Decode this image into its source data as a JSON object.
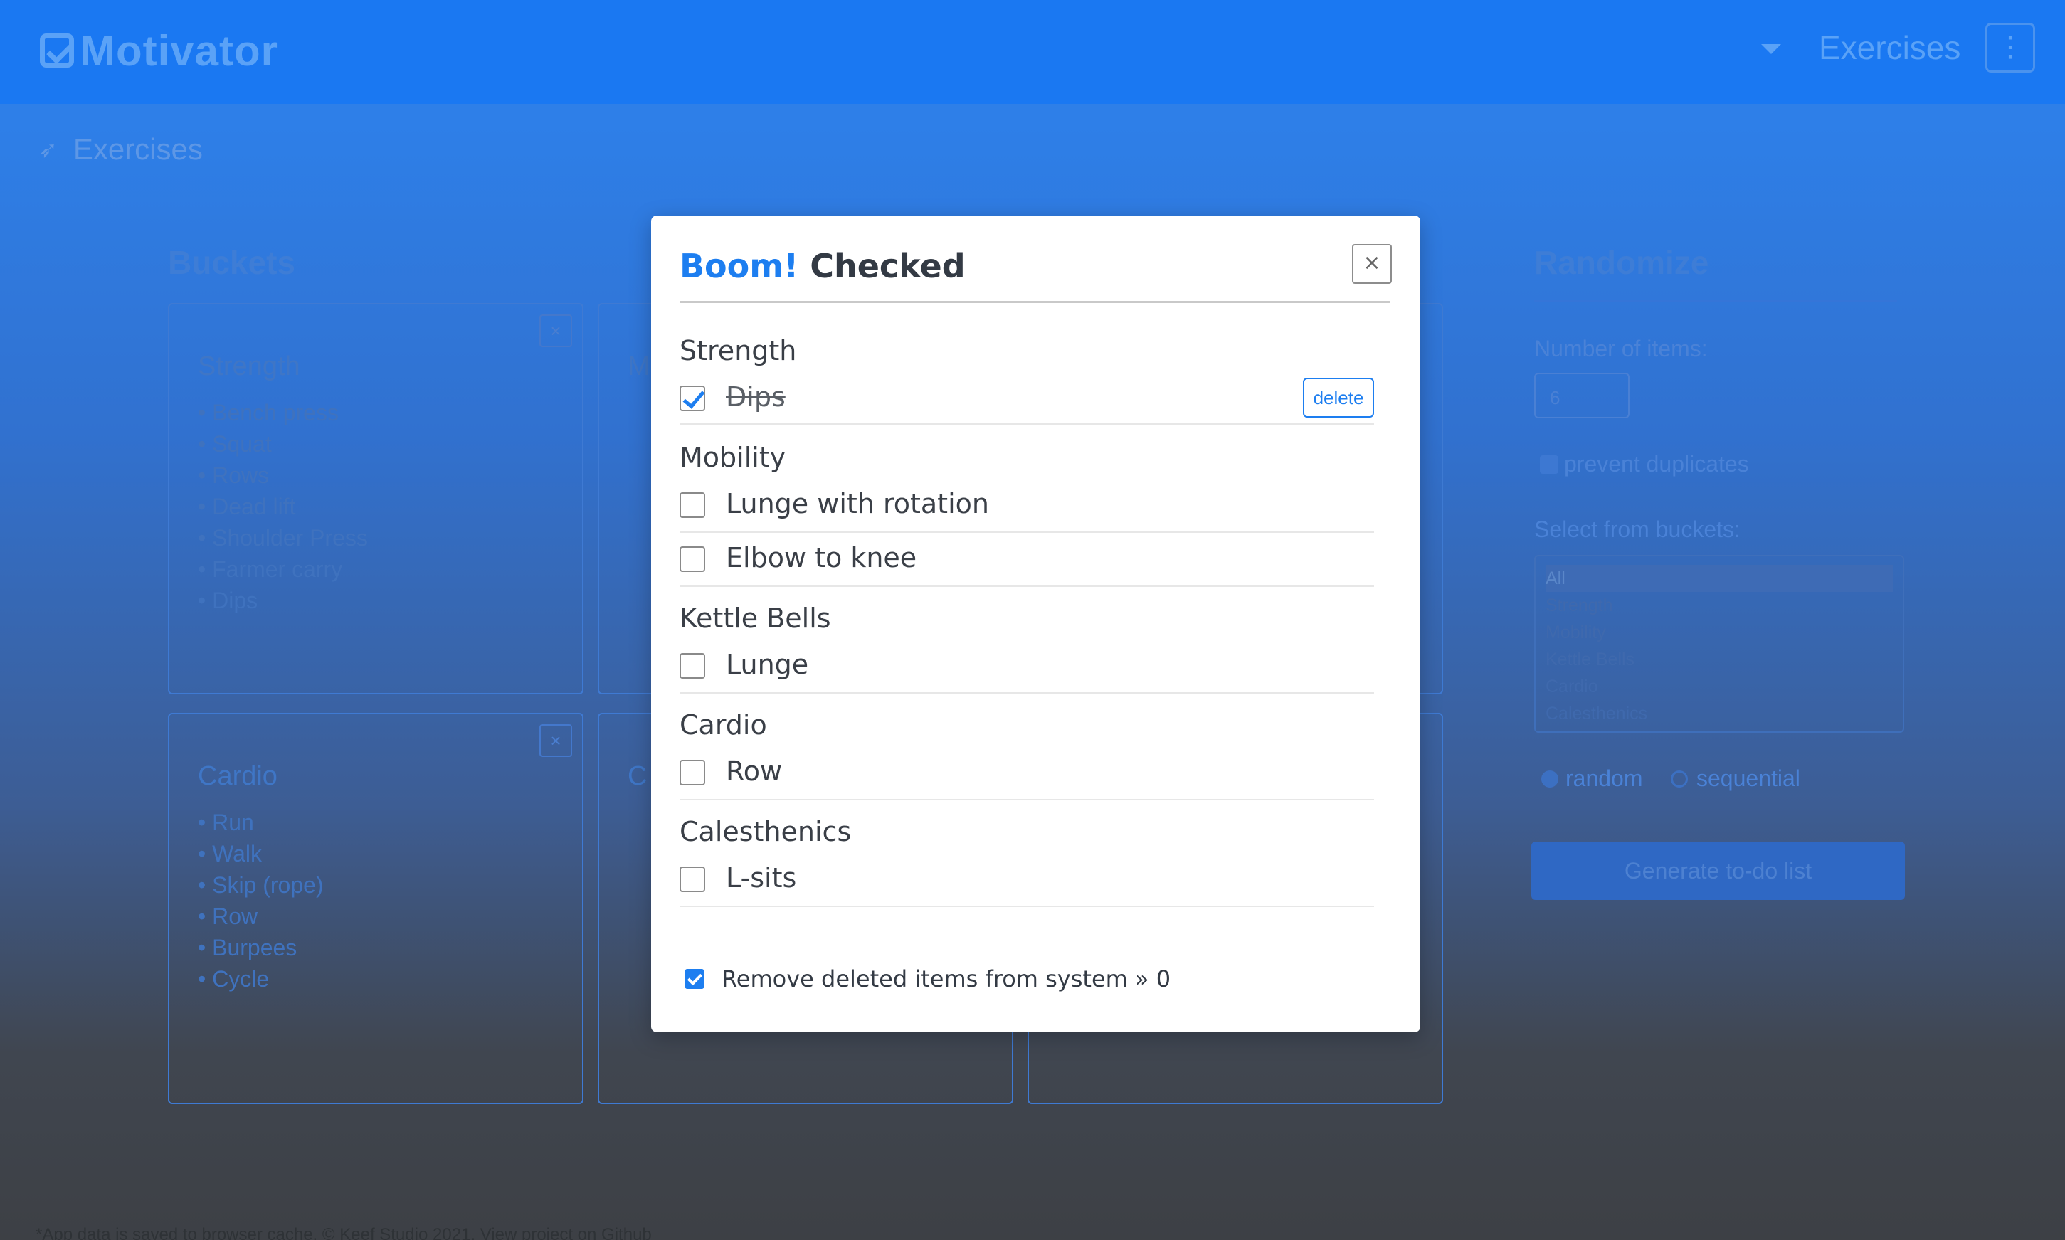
{
  "navbar": {
    "brand": "Motivator",
    "nav_link": "Exercises",
    "menu_glyph": "⋮"
  },
  "page": {
    "heading": "Exercises"
  },
  "buckets": {
    "title": "Buckets",
    "cards": [
      {
        "title": "Strength",
        "items": [
          "Bench press",
          "Squat",
          "Rows",
          "Dead lift",
          "Shoulder Press",
          "Farmer carry",
          "Dips"
        ]
      },
      {
        "title": "M"
      },
      {
        "title": "Cardio",
        "items": [
          "Run",
          "Walk",
          "Skip (rope)",
          "Row",
          "Burpees",
          "Cycle"
        ]
      },
      {
        "title": "C"
      }
    ]
  },
  "randomize": {
    "title": "Randomize",
    "number_label": "Number of items:",
    "number_value": "6",
    "prevent_duplicates_label": "prevent duplicates",
    "select_label": "Select from buckets:",
    "bucket_options": [
      "All",
      "Strength",
      "Mobility",
      "Kettle Bells",
      "Cardio",
      "Calesthenics"
    ],
    "random_label": "random",
    "sequential_label": "sequential",
    "generate_label": "Generate to-do list"
  },
  "footer": {
    "note": "*App data is saved to browser cache. © Keef Studio 2021. View project on Github"
  },
  "modal": {
    "title_accent": "Boom!",
    "title_rest": " Checked",
    "close_glyph": "×",
    "groups": [
      {
        "title": "Strength",
        "items": [
          {
            "label": "Dips",
            "checked": true
          }
        ]
      },
      {
        "title": "Mobility",
        "items": [
          {
            "label": "Lunge with rotation",
            "checked": false
          },
          {
            "label": "Elbow to knee",
            "checked": false
          }
        ]
      },
      {
        "title": "Kettle Bells",
        "items": [
          {
            "label": "Lunge",
            "checked": false
          }
        ]
      },
      {
        "title": "Cardio",
        "items": [
          {
            "label": "Row",
            "checked": false
          }
        ]
      },
      {
        "title": "Calesthenics",
        "items": [
          {
            "label": "L-sits",
            "checked": false
          }
        ]
      }
    ],
    "delete_label": "delete",
    "remove_label": "Remove deleted items from system » 0"
  },
  "colors": {
    "accent": "#1d7ef0",
    "navbar": "#1a78f2"
  }
}
